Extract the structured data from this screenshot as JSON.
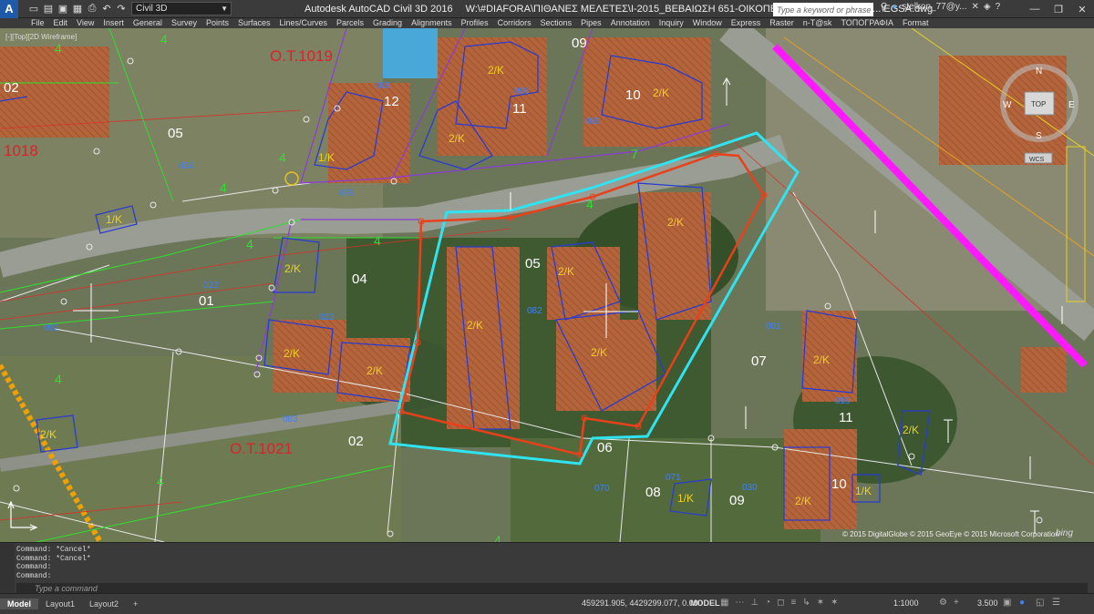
{
  "titlebar": {
    "logo": "A",
    "workspace": "Civil 3D",
    "app_title": "Autodesk AutoCAD Civil 3D 2016",
    "file_title": "W:\\#DIAFORA\\ΠΙΘΑΝΕΣ ΜΕΛΕΤΕΣ\\I-2015_ΒΕΒΑΙΩΣΗ 651-ΟΙΚΟΠΕΔΟ ΣΤΟ ΠΟΛΥΧΡΟΝ...\\EGSA.dwg",
    "search_placeholder": "Type a keyword or phrase",
    "user": "stelkon_77@y..."
  },
  "menu": [
    "File",
    "Edit",
    "View",
    "Insert",
    "General",
    "Survey",
    "Points",
    "Surfaces",
    "Lines/Curves",
    "Parcels",
    "Grading",
    "Alignments",
    "Profiles",
    "Corridors",
    "Sections",
    "Pipes",
    "Annotation",
    "Inquiry",
    "Window",
    "Express",
    "Raster",
    "n-T@sk",
    "ΤΟΠΟΓΡΑΦΙΑ",
    "Format"
  ],
  "viewport": {
    "label": "[-][Top][2D Wireframe]",
    "copyright": "© 2015 DigitalGlobe © 2015 GeoEye © 2015 Microsoft Corporation",
    "bing": "bing",
    "viewcube": {
      "top": "TOP",
      "n": "N",
      "s": "S",
      "e": "E",
      "w": "W",
      "wcs": "WCS"
    },
    "block_labels": [
      "O.T.1019",
      "1018",
      "O.T.1021"
    ],
    "parcel_numbers": [
      "09",
      "10",
      "12",
      "11",
      "05",
      "01",
      "04",
      "05",
      "07",
      "11",
      "02",
      "06",
      "08",
      "09",
      "10",
      "02"
    ],
    "building_labels": [
      "2/K",
      "2/K",
      "2/K",
      "1/K",
      "1/K",
      "2/K",
      "2/K",
      "2/K",
      "2/K",
      "2/K",
      "2/K",
      "2/K",
      "2/K",
      "2/K",
      "2/K",
      "1/K",
      "1/K",
      "2/K",
      "1/K",
      "2/K",
      "1/K"
    ],
    "small_codes": [
      "090",
      "089",
      "088",
      "034",
      "079",
      "082",
      "023",
      "022",
      "092",
      "081",
      "083",
      "019",
      "070",
      "071",
      "030"
    ],
    "zone_numbers": [
      "4",
      "4",
      "4",
      "4",
      "7",
      "4",
      "4",
      "4",
      "4",
      "4",
      "4"
    ]
  },
  "command": {
    "history": [
      "Command: *Cancel*",
      "Command: *Cancel*",
      "Command:",
      "Command:"
    ],
    "placeholder": "Type a command"
  },
  "statusbar": {
    "tabs": [
      "Model",
      "Layout1",
      "Layout2",
      "+"
    ],
    "coords": "459291.905, 4429299.077, 0.000",
    "model": "MODEL",
    "scale": "1:1000",
    "anno_scale": "3.500"
  },
  "colors": {
    "parcel_red": "#e8401a",
    "parcel_cyan": "#2fe3f0",
    "boundary_magenta": "#ff19ff",
    "building_blue": "#2a3cd0",
    "label_red": "#e0202a",
    "zone_green": "#2de02d",
    "road_gray": "#8f9388"
  }
}
